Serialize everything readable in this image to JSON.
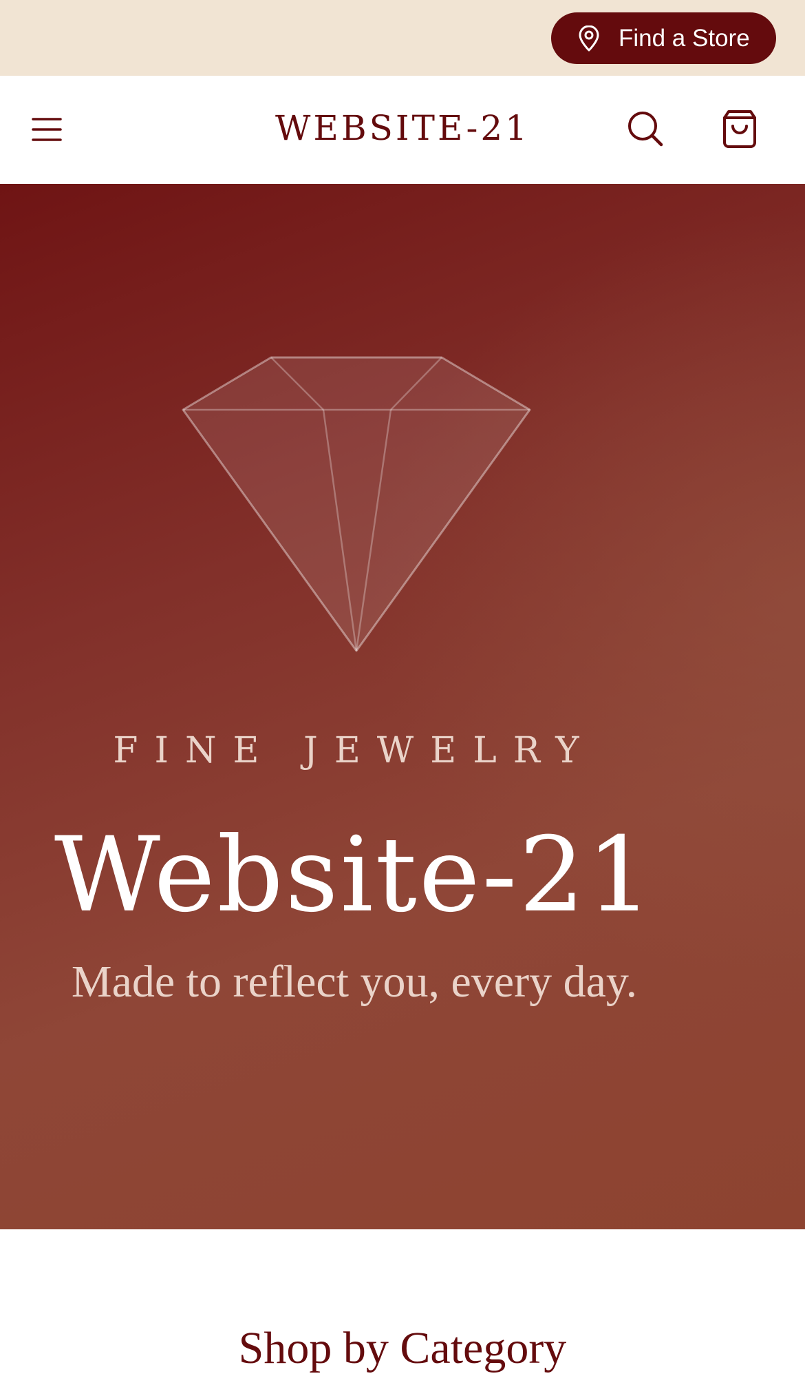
{
  "topbar": {
    "find_store_label": "Find a Store",
    "pin_icon": "map-pin-icon"
  },
  "header": {
    "brand": "WEBSITE-21",
    "menu_icon": "hamburger-menu-icon",
    "search_icon": "search-icon",
    "cart_icon": "shopping-bag-icon"
  },
  "hero": {
    "eyebrow": "FINE JEWELRY",
    "title": "Website-21",
    "subtitle": "Made to reflect you, every day.",
    "graphic_icon": "diamond-icon"
  },
  "categories": {
    "heading": "Shop by Category"
  },
  "colors": {
    "brand": "#640b0d",
    "topbar_bg": "#f1e4d3",
    "hero_gradient_start": "#6f1414",
    "hero_gradient_end": "#8d4330",
    "hero_text_light": "#ead3c9"
  }
}
